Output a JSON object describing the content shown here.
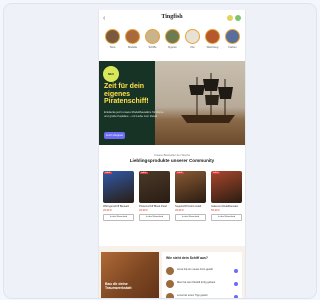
{
  "header": {
    "brand": "Tingfish",
    "back_icon": "chevron-left-icon"
  },
  "stories": [
    {
      "label": "Tiere",
      "color": "#7a5a3e"
    },
    {
      "label": "Modelle",
      "color": "#a86a3a"
    },
    {
      "label": "Schiffe",
      "color": "#c9b38a"
    },
    {
      "label": "Figuren",
      "color": "#6e7b50"
    },
    {
      "label": "Kits",
      "color": "#e7e1d6"
    },
    {
      "label": "Werkzeug",
      "color": "#b5582c"
    },
    {
      "label": "Farben",
      "color": "#5a6e9b"
    }
  ],
  "hero": {
    "badge": "NEU",
    "title": "Zeit für dein eigenes Piratenschiff!",
    "subtitle": "Entdecke jetzt unsere Modellbausätze für kleine und große Kapitäne – mit Liebe zum Detail.",
    "button": "Jetzt shoppen"
  },
  "section": {
    "kicker": "Unsere Bestseller der Woche",
    "title": "Lieblingsprodukte unserer Community"
  },
  "products": [
    {
      "tag": "SALE",
      "name": "Wikingerschiff Bausatz",
      "price": "29,99 €",
      "cta": "In den Warenkorb",
      "color": "#2f5aa8"
    },
    {
      "tag": "SALE",
      "name": "Piratenschiff Black Pearl",
      "price": "49,99 €",
      "cta": "In den Warenkorb",
      "color": "#4a3a2a"
    },
    {
      "tag": "SALE",
      "name": "Segelschiff Holzmodell",
      "price": "39,99 €",
      "cta": "In den Warenkorb",
      "color": "#8a5a34"
    },
    {
      "tag": "SALE",
      "name": "Galeone Modellbausatz",
      "price": "59,99 €",
      "cta": "In den Warenkorb",
      "color": "#a8472c"
    }
  ],
  "community": {
    "image_text": "Bau dir deine Traumwerkstatt",
    "panel_title": "Wie sieht dein Schiff aus?",
    "rows": [
      {
        "text": "Anna hat ein neues Foto geteilt"
      },
      {
        "text": "Max hat sein Modell fertig gebaut"
      },
      {
        "text": "Lena hat einen Tipp geteilt"
      }
    ]
  }
}
